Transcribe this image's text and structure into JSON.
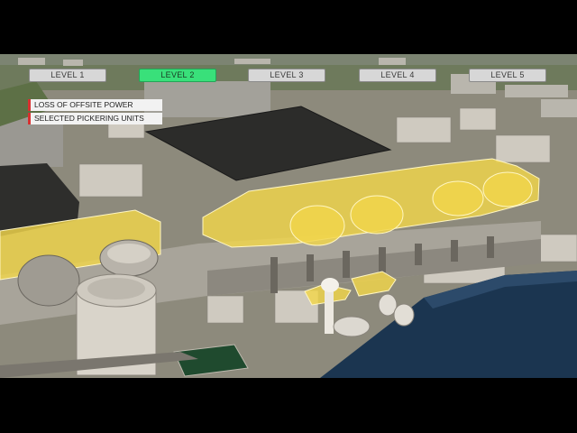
{
  "levels": [
    {
      "label": "LEVEL 1",
      "active": false
    },
    {
      "label": "LEVEL 2",
      "active": true
    },
    {
      "label": "LEVEL 3",
      "active": false
    },
    {
      "label": "LEVEL 4",
      "active": false
    },
    {
      "label": "LEVEL 5",
      "active": false
    }
  ],
  "legend": [
    {
      "label": "LOSS OF OFFSITE POWER",
      "color": "#d93030"
    },
    {
      "label": "SELECTED PICKERING UNITS",
      "color": "#d93030"
    }
  ],
  "colors": {
    "active_tab": "#39e07a",
    "inactive_tab": "#d7d7d7",
    "highlight": "#f2d64a",
    "water": "#1b3550",
    "letterbox": "#000000"
  }
}
